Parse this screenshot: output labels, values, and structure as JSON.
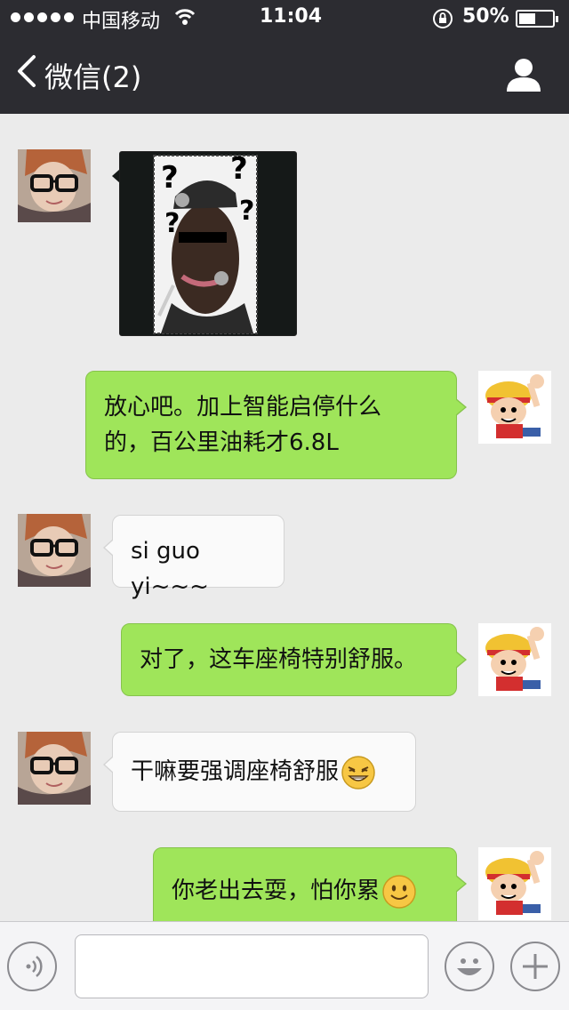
{
  "status_bar": {
    "carrier": "中国移动",
    "time": "11:04",
    "battery_percent": "50%",
    "battery_level": 0.5
  },
  "nav": {
    "title": "微信(2)",
    "back_icon": "chevron-left-icon",
    "profile_icon": "person-icon"
  },
  "messages": [
    {
      "side": "left",
      "type": "image",
      "sender": "friend",
      "image_desc": "meme-photo"
    },
    {
      "side": "right",
      "type": "text",
      "sender": "me",
      "lines": [
        "放心吧。加上智能启停什么",
        "的，百公里油耗才6.8L"
      ]
    },
    {
      "side": "left",
      "type": "text",
      "sender": "friend",
      "lines": [
        "si guo yi~~~"
      ]
    },
    {
      "side": "right",
      "type": "text",
      "sender": "me",
      "lines": [
        "对了，这车座椅特别舒服。"
      ]
    },
    {
      "side": "left",
      "type": "text",
      "sender": "friend",
      "lines": [
        "干嘛要强调座椅舒服"
      ],
      "emoji": "grin-emoji"
    },
    {
      "side": "right",
      "type": "text",
      "sender": "me",
      "lines": [
        "你老出去耍，怕你累"
      ],
      "emoji": "smile-emoji"
    }
  ],
  "input_bar": {
    "voice_icon": "voice-icon",
    "text_value": "",
    "emoji_icon": "smiley-icon",
    "add_icon": "plus-icon"
  },
  "colors": {
    "nav_bg": "#2c2c31",
    "chat_bg": "#ebebeb",
    "my_bubble": "#9fe55a",
    "friend_bubble": "#fafafa"
  }
}
